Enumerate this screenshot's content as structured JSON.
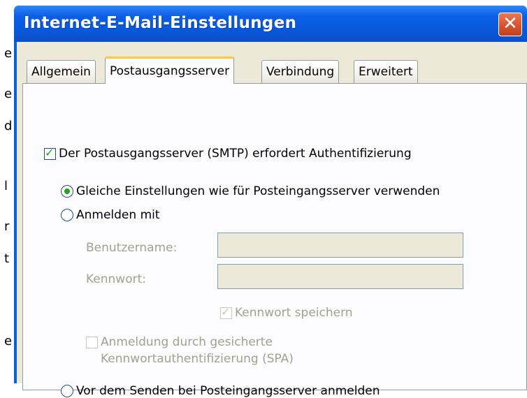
{
  "dialog": {
    "title": "Internet-E-Mail-Einstellungen",
    "close_glyph": "✕"
  },
  "tabs": [
    {
      "label": "Allgemein",
      "active": false
    },
    {
      "label": "Postausgangsserver",
      "active": true
    },
    {
      "label": "Verbindung",
      "active": false
    },
    {
      "label": "Erweitert",
      "active": false
    }
  ],
  "smtp_auth": {
    "label": "Der Postausgangsserver (SMTP) erfordert Authentifizierung",
    "checked": true
  },
  "auth_options": {
    "same_settings": {
      "label": "Gleiche Einstellungen wie für Posteingangsserver verwenden",
      "selected": true
    },
    "login_with": {
      "label": "Anmelden mit",
      "selected": false
    },
    "login_before_send": {
      "label": "Vor dem Senden bei Posteingangsserver anmelden",
      "selected": false
    }
  },
  "credentials": {
    "username_label": "Benutzername:",
    "username_value": "",
    "password_label": "Kennwort:",
    "password_value": "",
    "remember_password": {
      "label": "Kennwort speichern",
      "checked": true,
      "enabled": false
    },
    "spa": {
      "line1": "Anmeldung durch gesicherte",
      "line2": "Kennwortauthentifizierung (SPA)",
      "checked": false,
      "enabled": false
    }
  },
  "colors": {
    "titlebar": "#0a5fe0",
    "check_mark": "#21a121",
    "active_tab_highlight": "#ffc73c",
    "dialog_face": "#ece9d8"
  }
}
